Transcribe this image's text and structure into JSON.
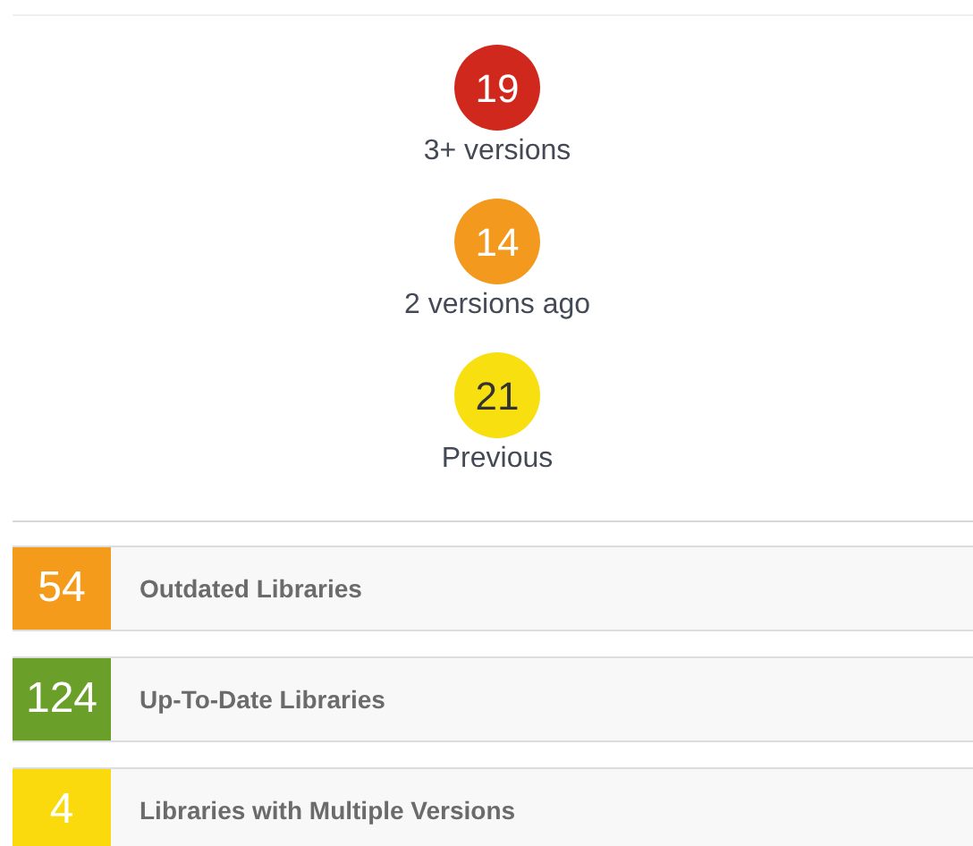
{
  "version_counts": [
    {
      "count": "19",
      "label": "3+ versions",
      "color": "#d0281c"
    },
    {
      "count": "14",
      "label": "2 versions ago",
      "color": "#f39a1e"
    },
    {
      "count": "21",
      "label": "Previous",
      "color": "#f8df10"
    }
  ],
  "summary_rows": [
    {
      "count": "54",
      "label": "Outdated Libraries",
      "color": "#f59b1c"
    },
    {
      "count": "124",
      "label": "Up-To-Date Libraries",
      "color": "#6a9f2a"
    },
    {
      "count": "4",
      "label": "Libraries with Multiple Versions",
      "color": "#fada0c"
    }
  ]
}
